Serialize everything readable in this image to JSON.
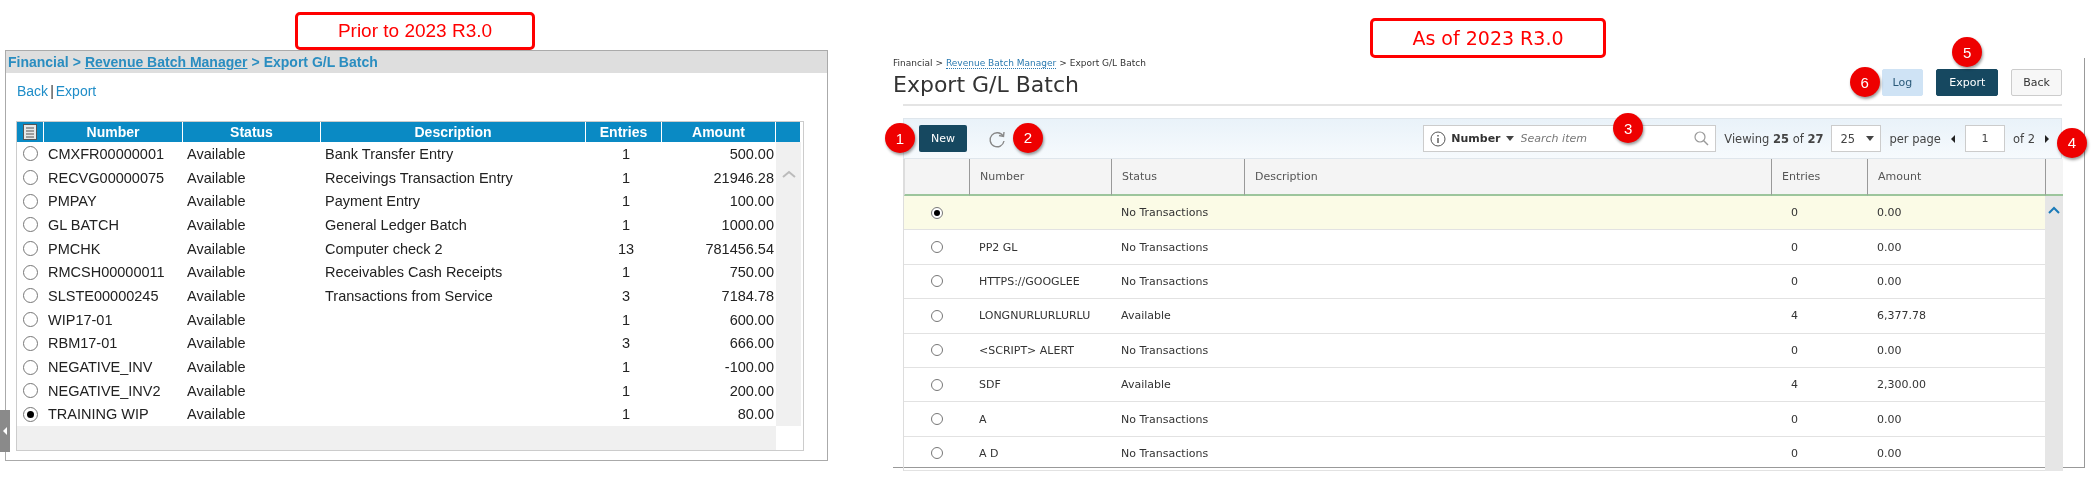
{
  "legacy_screen": {
    "caption": "Prior to 2023 R3.0",
    "breadcrumb": [
      {
        "kind": "text",
        "text": "Financial"
      },
      {
        "kind": "separator",
        "text": ">"
      },
      {
        "kind": "link",
        "text": "Revenue Batch Manager"
      },
      {
        "kind": "separator",
        "text": ">"
      },
      {
        "kind": "text",
        "text": "Export G/L Batch"
      }
    ],
    "actions": [
      {
        "kind": "link",
        "text": "Back"
      },
      {
        "kind": "separator",
        "text": "|"
      },
      {
        "kind": "link",
        "text": "Export"
      }
    ],
    "table": {
      "columns": [
        "Number",
        "Status",
        "Description",
        "Entries",
        "Amount"
      ],
      "rows": [
        {
          "selected": false,
          "cells": [
            "CMXFR00000001",
            "Available",
            "Bank Transfer Entry",
            "1",
            "500.00"
          ]
        },
        {
          "selected": false,
          "cells": [
            "RECVG00000075",
            "Available",
            "Receivings Transaction Entry",
            "1",
            "21946.28"
          ]
        },
        {
          "selected": false,
          "cells": [
            "PMPAY",
            "Available",
            "Payment Entry",
            "1",
            "100.00"
          ]
        },
        {
          "selected": false,
          "cells": [
            "GL BATCH",
            "Available",
            "General Ledger Batch",
            "1",
            "1000.00"
          ]
        },
        {
          "selected": false,
          "cells": [
            "PMCHK",
            "Available",
            "Computer check 2",
            "13",
            "781456.54"
          ]
        },
        {
          "selected": false,
          "cells": [
            "RMCSH00000011",
            "Available",
            "Receivables Cash Receipts",
            "1",
            "750.00"
          ]
        },
        {
          "selected": false,
          "cells": [
            "SLSTE00000245",
            "Available",
            "Transactions from Service",
            "3",
            "7184.78"
          ]
        },
        {
          "selected": false,
          "cells": [
            "WIP17-01",
            "Available",
            "",
            "1",
            "600.00"
          ]
        },
        {
          "selected": false,
          "cells": [
            "RBM17-01",
            "Available",
            "",
            "3",
            "666.00"
          ]
        },
        {
          "selected": false,
          "cells": [
            "NEGATIVE_INV",
            "Available",
            "",
            "1",
            "-100.00"
          ]
        },
        {
          "selected": false,
          "cells": [
            "NEGATIVE_INV2",
            "Available",
            "",
            "1",
            "200.00"
          ]
        },
        {
          "selected": true,
          "cells": [
            "TRAINING WIP",
            "Available",
            "",
            "1",
            "80.00"
          ]
        }
      ]
    }
  },
  "current_screen": {
    "caption": "As of 2023 R3.0",
    "breadcrumb": [
      {
        "kind": "text",
        "text": "Financial"
      },
      {
        "kind": "separator",
        "text": ">"
      },
      {
        "kind": "link",
        "text": "Revenue Batch Manager"
      },
      {
        "kind": "separator",
        "text": ">"
      },
      {
        "kind": "text",
        "text": "Export G/L Batch"
      }
    ],
    "title": "Export G/L Batch",
    "header_buttons": [
      {
        "kind": "light",
        "label": "Log",
        "callout": "6"
      },
      {
        "kind": "primary",
        "label": "Export",
        "callout": "5"
      },
      {
        "kind": "default",
        "label": "Back"
      }
    ],
    "toolbar": {
      "new_button": {
        "label": "New",
        "callout": "1"
      },
      "refresh_callout": "2",
      "search": {
        "field": "Number",
        "placeholder": "Search item",
        "callout": "3"
      },
      "viewing": "Viewing **25** of **27**",
      "page_size": "25",
      "per_page": "per page",
      "page": "1",
      "page_count": "of 2",
      "pager_callout": "4"
    },
    "table": {
      "columns": [
        "Number",
        "Status",
        "Description",
        "Entries",
        "Amount"
      ],
      "rows": [
        {
          "selected": true,
          "cells": [
            "",
            "No Transactions",
            "",
            "0",
            "0.00"
          ]
        },
        {
          "selected": false,
          "cells": [
            "PP2 GL",
            "No Transactions",
            "",
            "0",
            "0.00"
          ]
        },
        {
          "selected": false,
          "cells": [
            "HTTPS://GOOGLEE",
            "No Transactions",
            "",
            "0",
            "0.00"
          ]
        },
        {
          "selected": false,
          "cells": [
            "LONGNURLURLURLU",
            "Available",
            "",
            "4",
            "6,377.78"
          ]
        },
        {
          "selected": false,
          "cells": [
            "<SCRIPT> ALERT",
            "No Transactions",
            "",
            "0",
            "0.00"
          ]
        },
        {
          "selected": false,
          "cells": [
            "SDF",
            "Available",
            "",
            "4",
            "2,300.00"
          ]
        },
        {
          "selected": false,
          "cells": [
            "A",
            "No Transactions",
            "",
            "0",
            "0.00"
          ]
        },
        {
          "selected": false,
          "cells": [
            "A D",
            "No Transactions",
            "",
            "0",
            "0.00"
          ]
        }
      ]
    }
  }
}
